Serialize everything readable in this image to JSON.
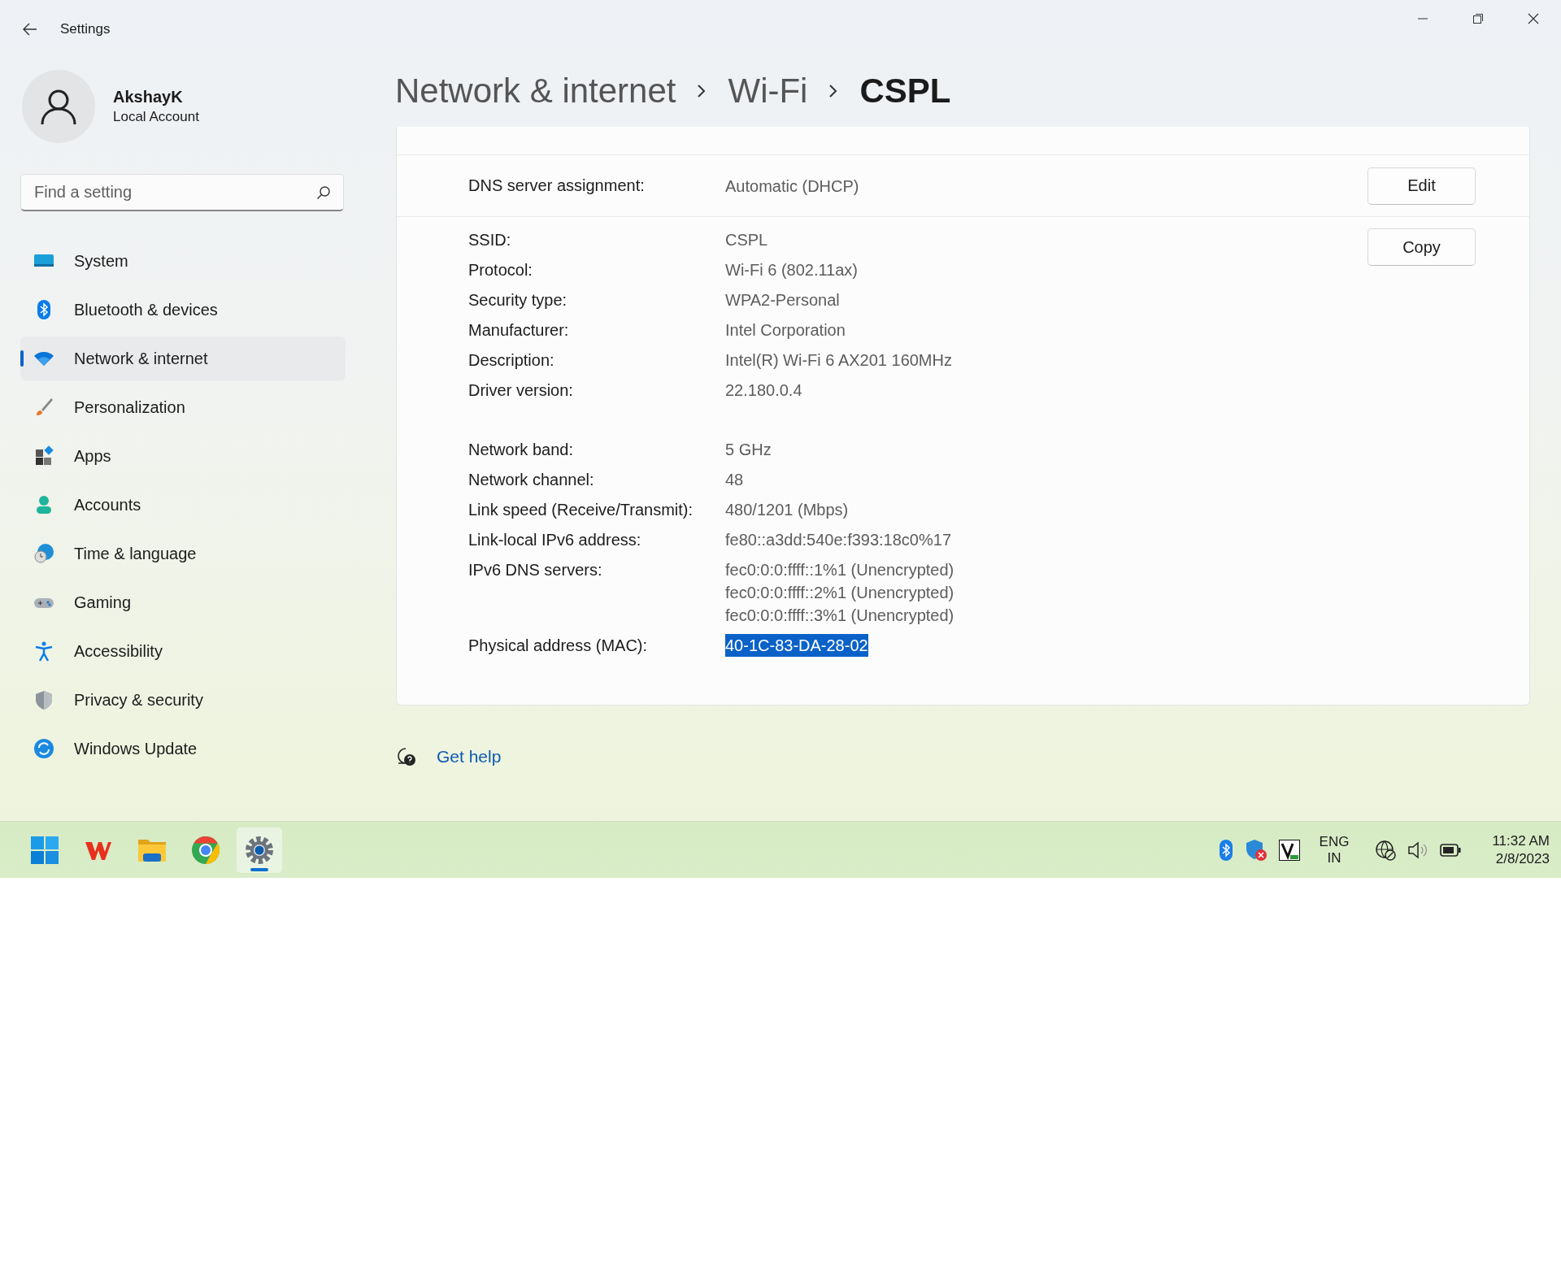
{
  "window": {
    "title": "Settings"
  },
  "account": {
    "name": "AkshayK",
    "type": "Local Account"
  },
  "search": {
    "placeholder": "Find a setting"
  },
  "sidebar": {
    "items": [
      {
        "label": "System",
        "kind": "system",
        "selected": false
      },
      {
        "label": "Bluetooth & devices",
        "kind": "bluetooth",
        "selected": false
      },
      {
        "label": "Network & internet",
        "kind": "network",
        "selected": true
      },
      {
        "label": "Personalization",
        "kind": "brush",
        "selected": false
      },
      {
        "label": "Apps",
        "kind": "apps",
        "selected": false
      },
      {
        "label": "Accounts",
        "kind": "person",
        "selected": false
      },
      {
        "label": "Time & language",
        "kind": "globe",
        "selected": false
      },
      {
        "label": "Gaming",
        "kind": "gamepad",
        "selected": false
      },
      {
        "label": "Accessibility",
        "kind": "accessibility",
        "selected": false
      },
      {
        "label": "Privacy & security",
        "kind": "shield",
        "selected": false
      },
      {
        "label": "Windows Update",
        "kind": "update",
        "selected": false
      }
    ]
  },
  "breadcrumb": [
    {
      "label": "Network & internet",
      "current": false
    },
    {
      "label": "Wi-Fi",
      "current": false
    },
    {
      "label": "CSPL",
      "current": true
    }
  ],
  "dns": {
    "label": "DNS server assignment:",
    "value": "Automatic (DHCP)",
    "button": "Edit"
  },
  "properties": {
    "copy_button": "Copy",
    "groups": [
      {
        "rows": [
          {
            "label": "SSID:",
            "values": [
              "CSPL"
            ],
            "selected": false
          },
          {
            "label": "Protocol:",
            "values": [
              "Wi-Fi 6 (802.11ax)"
            ],
            "selected": false
          },
          {
            "label": "Security type:",
            "values": [
              "WPA2-Personal"
            ],
            "selected": false
          },
          {
            "label": "Manufacturer:",
            "values": [
              "Intel Corporation"
            ],
            "selected": false
          },
          {
            "label": "Description:",
            "values": [
              "Intel(R) Wi-Fi 6 AX201 160MHz"
            ],
            "selected": false
          },
          {
            "label": "Driver version:",
            "values": [
              "22.180.0.4"
            ],
            "selected": false
          }
        ]
      },
      {
        "rows": [
          {
            "label": "Network band:",
            "values": [
              "5 GHz"
            ],
            "selected": false
          },
          {
            "label": "Network channel:",
            "values": [
              "48"
            ],
            "selected": false
          },
          {
            "label": "Link speed (Receive/Transmit):",
            "values": [
              "480/1201 (Mbps)"
            ],
            "selected": false
          },
          {
            "label": "Link-local IPv6 address:",
            "values": [
              "fe80::a3dd:540e:f393:18c0%17"
            ],
            "selected": false
          },
          {
            "label": "IPv6 DNS servers:",
            "values": [
              "fec0:0:0:ffff::1%1 (Unencrypted)",
              "fec0:0:0:ffff::2%1 (Unencrypted)",
              "fec0:0:0:ffff::3%1 (Unencrypted)"
            ],
            "selected": false
          },
          {
            "label": "Physical address (MAC):",
            "values": [
              "40-1C-83-DA-28-02"
            ],
            "selected": true
          }
        ]
      }
    ]
  },
  "help": {
    "label": "Get help"
  },
  "taskbar": {
    "apps": [
      {
        "kind": "start",
        "selected": false
      },
      {
        "kind": "office",
        "selected": false
      },
      {
        "kind": "folder",
        "selected": false
      },
      {
        "kind": "browser",
        "selected": false
      },
      {
        "kind": "settings",
        "selected": true
      }
    ],
    "language": [
      "ENG",
      "IN"
    ],
    "time": "11:32 AM",
    "date": "2/8/2023"
  }
}
